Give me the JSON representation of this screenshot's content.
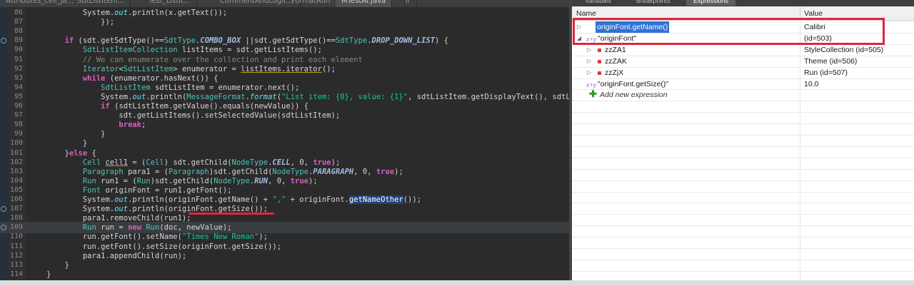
{
  "editor": {
    "tabs": [
      "Attributes_cell_ja...",
      "SdtListItem...",
      "Test_ListIt...",
      "CommentAndLogic...",
      "FormatRun",
      "MTestAI.java",
      "lr"
    ],
    "lines": [
      {
        "n": "86",
        "t": [
          [
            "st",
            "            System."
          ],
          [
            "fld",
            "out"
          ],
          [
            "st",
            ".println(x.getText());"
          ]
        ]
      },
      {
        "n": "87",
        "t": [
          [
            "st",
            "                });"
          ]
        ]
      },
      {
        "n": "88",
        "t": [
          [
            "st",
            ""
          ]
        ]
      },
      {
        "n": "89",
        "t": [
          [
            "kw",
            "        if"
          ],
          [
            "st",
            " (sdt.getSdtType()=="
          ],
          [
            "cl",
            "SdtType"
          ],
          [
            "st",
            "."
          ],
          [
            "cst",
            "COMBO_BOX"
          ],
          [
            "st",
            " ||sdt.getSdtType()=="
          ],
          [
            "cl",
            "SdtType"
          ],
          [
            "st",
            "."
          ],
          [
            "cst",
            "DROP_DOWN_LIST"
          ],
          [
            "st",
            ") {"
          ]
        ],
        "bp": true
      },
      {
        "n": "90",
        "t": [
          [
            "cl",
            "            SdtListItemCollection"
          ],
          [
            "st",
            " listItems = sdt.getListItems();"
          ]
        ]
      },
      {
        "n": "91",
        "t": [
          [
            "cm",
            "            // We can enumerate over the collection and print each element"
          ]
        ]
      },
      {
        "n": "92",
        "t": [
          [
            "cl",
            "            Iterator"
          ],
          [
            "st",
            "<"
          ],
          [
            "cl",
            "SdtListItem"
          ],
          [
            "st",
            "> enumerator = "
          ],
          [
            "under",
            "listItems.iterator"
          ],
          [
            "st",
            "();"
          ]
        ]
      },
      {
        "n": "93",
        "t": [
          [
            "kw",
            "            while"
          ],
          [
            "st",
            " (enumerator.hasNext()) {"
          ]
        ]
      },
      {
        "n": "94",
        "t": [
          [
            "cl",
            "                SdtListItem"
          ],
          [
            "st",
            " sdtListItem = enumerator.next();"
          ]
        ]
      },
      {
        "n": "95",
        "t": [
          [
            "st",
            "                System."
          ],
          [
            "fld",
            "out"
          ],
          [
            "st",
            ".println("
          ],
          [
            "cl",
            "MessageFormat"
          ],
          [
            "st",
            "."
          ],
          [
            "fld",
            "format"
          ],
          [
            "st",
            "("
          ],
          [
            "str",
            "\"List item: {0}, value: {1}\""
          ],
          [
            "st",
            ", sdtListItem.getDisplayText(), sdtLis"
          ]
        ]
      },
      {
        "n": "96",
        "t": [
          [
            "kw",
            "                if"
          ],
          [
            "st",
            " (sdtListItem.getValue().equals(newValue)) {"
          ]
        ]
      },
      {
        "n": "97",
        "t": [
          [
            "st",
            "                    sdt.getListItems().setSelectedValue(sdtListItem);"
          ]
        ]
      },
      {
        "n": "98",
        "t": [
          [
            "kw",
            "                    break"
          ],
          [
            "st",
            ";"
          ]
        ]
      },
      {
        "n": "99",
        "t": [
          [
            "st",
            "                }"
          ]
        ]
      },
      {
        "n": "100",
        "t": [
          [
            "st",
            "            }"
          ]
        ]
      },
      {
        "n": "101",
        "t": [
          [
            "st",
            "        }"
          ],
          [
            "kw",
            "else"
          ],
          [
            "st",
            " {"
          ]
        ]
      },
      {
        "n": "102",
        "t": [
          [
            "cl",
            "            Cell"
          ],
          [
            "st",
            " "
          ],
          [
            "under",
            "cell1"
          ],
          [
            "st",
            " = ("
          ],
          [
            "cl",
            "Cell"
          ],
          [
            "st",
            ") sdt.getChild("
          ],
          [
            "cl",
            "NodeType"
          ],
          [
            "st",
            "."
          ],
          [
            "cst",
            "CELL"
          ],
          [
            "st",
            ", 0, "
          ],
          [
            "kw",
            "true"
          ],
          [
            "st",
            ");"
          ]
        ]
      },
      {
        "n": "103",
        "t": [
          [
            "cl",
            "            Paragraph"
          ],
          [
            "st",
            " para1 = ("
          ],
          [
            "cl",
            "Paragraph"
          ],
          [
            "st",
            ")sdt.getChild("
          ],
          [
            "cl",
            "NodeType"
          ],
          [
            "st",
            "."
          ],
          [
            "cst",
            "PARAGRAPH"
          ],
          [
            "st",
            ", 0, "
          ],
          [
            "kw",
            "true"
          ],
          [
            "st",
            ");"
          ]
        ]
      },
      {
        "n": "104",
        "t": [
          [
            "cl",
            "            Run"
          ],
          [
            "st",
            " run1 = ("
          ],
          [
            "cl",
            "Run"
          ],
          [
            "st",
            ")sdt.getChild("
          ],
          [
            "cl",
            "NodeType"
          ],
          [
            "st",
            "."
          ],
          [
            "cst",
            "RUN"
          ],
          [
            "st",
            ", 0, "
          ],
          [
            "kw",
            "true"
          ],
          [
            "st",
            ");"
          ]
        ]
      },
      {
        "n": "105",
        "t": [
          [
            "cl",
            "            Font"
          ],
          [
            "st",
            " originFont = run1.getFont();"
          ]
        ]
      },
      {
        "n": "106",
        "t": [
          [
            "st",
            "            System."
          ],
          [
            "fld",
            "out"
          ],
          [
            "st",
            ".println(originFont.getName() + "
          ],
          [
            "str",
            "\",\""
          ],
          [
            "st",
            " + originFont."
          ],
          [
            "sel",
            "getNameOther"
          ],
          [
            "st",
            "());"
          ]
        ]
      },
      {
        "n": "107",
        "t": [
          [
            "st",
            "            System."
          ],
          [
            "fld",
            "out"
          ],
          [
            "st",
            ".println(originFont.getSize());"
          ]
        ],
        "bp": true
      },
      {
        "n": "108",
        "t": [
          [
            "st",
            "            para1.removeChild(run1);"
          ]
        ]
      },
      {
        "n": "109",
        "t": [
          [
            "cl",
            "            Run"
          ],
          [
            "st",
            " run = "
          ],
          [
            "kw",
            "new"
          ],
          [
            "st",
            " "
          ],
          [
            "cl",
            "Run"
          ],
          [
            "st",
            "(doc, newValue);"
          ]
        ],
        "hl": true,
        "bp": true
      },
      {
        "n": "110",
        "t": [
          [
            "st",
            "            run.getFont().setName("
          ],
          [
            "str",
            "\"Times New Roman\""
          ],
          [
            "st",
            ");"
          ]
        ]
      },
      {
        "n": "111",
        "t": [
          [
            "st",
            "            run.getFont().setSize(originFont.getSize());"
          ]
        ]
      },
      {
        "n": "112",
        "t": [
          [
            "st",
            "            para1.appendChild(run);"
          ]
        ]
      },
      {
        "n": "113",
        "t": [
          [
            "st",
            "        }"
          ]
        ]
      },
      {
        "n": "114",
        "t": [
          [
            "st",
            "    }"
          ]
        ]
      }
    ]
  },
  "panel": {
    "tabs": [
      "Variables",
      "Breakpoints",
      "Expressions"
    ],
    "header": {
      "name": "Name",
      "value": "Value"
    },
    "rows": [
      {
        "depth": 0,
        "twisty": "▷",
        "icon": "none",
        "name": "originFont.getName()",
        "value": "Calibri",
        "selected": true
      },
      {
        "depth": 0,
        "twisty": "◢",
        "icon": "var",
        "name": "\"originFont\"",
        "value": " (id=503)"
      },
      {
        "depth": 1,
        "twisty": "▷",
        "icon": "field",
        "name": "zzZA1",
        "value": "StyleCollection  (id=505)"
      },
      {
        "depth": 1,
        "twisty": "▷",
        "icon": "field",
        "name": "zzZAK",
        "value": "Theme  (id=506)"
      },
      {
        "depth": 1,
        "twisty": "▷",
        "icon": "field",
        "name": "zzZjX",
        "value": "Run  (id=507)"
      },
      {
        "depth": 0,
        "twisty": "",
        "icon": "var",
        "name": "\"originFont.getSize()\"",
        "value": "10.0"
      },
      {
        "depth": 0,
        "twisty": "",
        "icon": "add",
        "name": "Add new expression",
        "value": ""
      }
    ]
  },
  "icons": {
    "var": "x+y",
    "add": "✚"
  }
}
